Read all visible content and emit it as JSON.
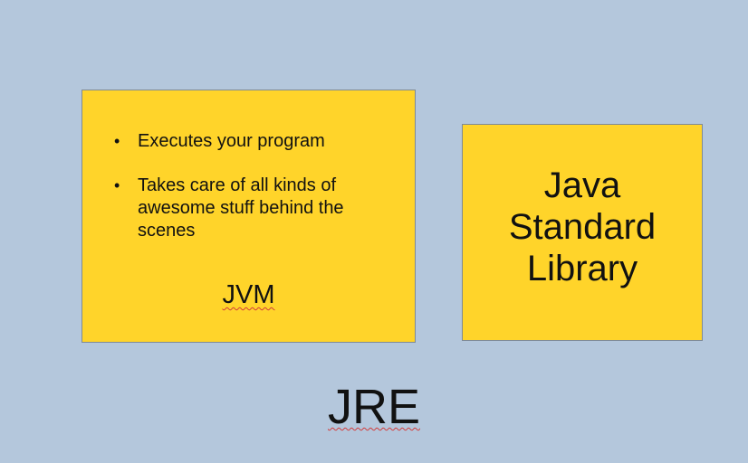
{
  "diagram": {
    "jvm_box": {
      "bullets": [
        {
          "text": "Executes your program"
        },
        {
          "text": "Takes care of all kinds of awesome stuff behind the scenes"
        }
      ],
      "label": "JVM"
    },
    "library_box": {
      "lines": [
        "Java",
        "Standard",
        "Library"
      ]
    },
    "outer_label": "JRE",
    "colors": {
      "background": "#b4c7dc",
      "box_fill": "#ffd42a",
      "spellcheck_underline": "#d23b3b"
    }
  }
}
